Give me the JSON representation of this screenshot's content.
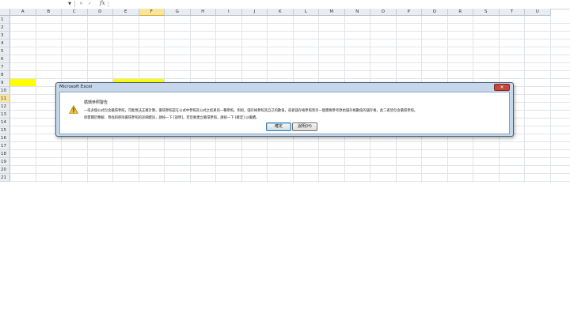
{
  "formula_bar": {
    "name_box_value": "",
    "cancel_symbol": "✕",
    "enter_symbol": "✓",
    "fx_label": "fx",
    "formula_value": ""
  },
  "sheet": {
    "columns": [
      "A",
      "B",
      "C",
      "D",
      "E",
      "F",
      "G",
      "H",
      "I",
      "J",
      "K",
      "L",
      "M",
      "N",
      "O",
      "P",
      "Q",
      "R",
      "S",
      "T",
      "U"
    ],
    "rows": [
      "1",
      "2",
      "3",
      "4",
      "5",
      "6",
      "7",
      "8",
      "9",
      "10",
      "11",
      "12",
      "13",
      "14",
      "15",
      "16",
      "17",
      "18",
      "19",
      "20",
      "21"
    ],
    "selected_column": "F",
    "selected_row": "11",
    "highlight_color": "#ffff00",
    "header_selected_color": "#f7e59a"
  },
  "dialog": {
    "title": "Microsoft Excel",
    "close_symbol": "✕",
    "heading": "循環參照警告",
    "message_line1": "一或多個公式包含循環參照，可能無法正確計算。循環參照是在公式中參照其公式之結果的一種參照。例如，儲存格參照其自己的數值，或者儲存格參照到另一個需要參考原始儲存格數值的儲存格，此二者皆包含循環參照。",
    "message_line2": "如需關於瞭解、尋找和移除循環參照的詳細資訊，請按一下 [說明]。若您要建立循環參照，請按一下 [確定] 以繼續。",
    "ok_label": "確定",
    "help_label": "說明(H)",
    "warning_icon": "warning-triangle-icon"
  }
}
